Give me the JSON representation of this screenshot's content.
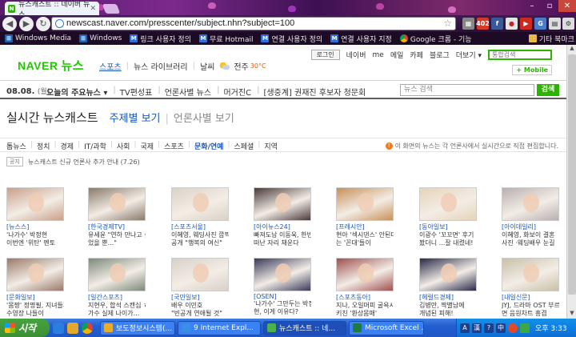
{
  "browser": {
    "tabs": [
      {
        "label": "뉴스캐스트 :: 네이버 뉴스",
        "active": true
      },
      {
        "label": "",
        "active": false
      }
    ],
    "url": "newscast.naver.com/presscenter/subject.nhn?subject=100"
  },
  "bookmarks": [
    {
      "label": "Windows Media",
      "icon": "windows-icon"
    },
    {
      "label": "Windows",
      "icon": "windows-icon"
    },
    {
      "label": "링크 사용자 정의",
      "icon": "ms-icon"
    },
    {
      "label": "무료 Hotmail",
      "icon": "ms-icon"
    },
    {
      "label": "연결 사용자 정의",
      "icon": "ms-icon"
    },
    {
      "label": "연결 사용자 지정",
      "icon": "ms-icon"
    },
    {
      "label": "Google 크롬 - 기능",
      "icon": "chrome-icon"
    },
    {
      "label": "기타 북마크",
      "icon": "folder-icon"
    }
  ],
  "naver": {
    "logo": "NAVER",
    "logo_news": "뉴스",
    "top_menu": [
      "스포츠",
      "뉴스 라이브러리",
      "날씨"
    ],
    "weather": {
      "city": "전주",
      "temp": "30°C"
    },
    "nav_links": [
      "로그인",
      "네이버",
      "me",
      "메일",
      "카페",
      "블로그",
      "더보기 ▾"
    ],
    "top_search_placeholder": "통합검색",
    "mobile": "+ Mobile",
    "date": "08.08.",
    "day": "(월)",
    "sub_menu": [
      "오늘의 주요뉴스 ▾",
      "TV편성표",
      "언론사별 뉴스",
      "머거진C",
      "[생중계] 권재진 후보자 청문회"
    ],
    "news_search_placeholder": "뉴스 검색",
    "search_button": "검색",
    "page_title": "실시간 뉴스캐스트",
    "view_by_topic": "주제별 보기",
    "view_by_press": "언론사별 보기",
    "categories": [
      "톱뉴스",
      "정치",
      "경제",
      "IT/과학",
      "사회",
      "국제",
      "스포츠",
      "문화/연예",
      "스페셜",
      "지역"
    ],
    "active_category": "문화/연예",
    "category_note": "이 화면의 뉴스는 각 언론사에서 실시간으로 직접 편집합니다.",
    "notice_tag": "공지",
    "notice_text": "뉴스캐스트 신규 언론사 추가 안내 (7.26)"
  },
  "cards": [
    {
      "source": "[뉴스스]",
      "line1": "'나가수' 박정현",
      "line2": "이번엔 '위탄' 멘토",
      "color": "#c9a08a"
    },
    {
      "source": "[한국경제TV]",
      "line1": "유세윤 \"연하 만나고 싶",
      "line2": "었을 뿐...\"",
      "color": "#8a7a6a"
    },
    {
      "source": "[스포츠서울]",
      "line1": "이혜영, 웨딩사진 깜짝",
      "line2": "공개 \"행복의 여신\"",
      "color": "#d9d2c6"
    },
    {
      "source": "[아이뉴스24]",
      "line1": "빠져도남 이동욱, 한빈",
      "line2": "떠난 자리 채운다",
      "color": "#4a3a3a"
    },
    {
      "source": "[프레시안]",
      "line1": "현아 '섹시댄스' 안된다",
      "line2": "는 '꼰대'들이",
      "color": "#c8915a"
    },
    {
      "source": "[동아일보]",
      "line1": "이광수 '꼬꼬면' 후기",
      "line2": "봤더니 ...잘 내켰네!",
      "color": "#e6d3b8"
    },
    {
      "source": "[아이데일리]",
      "line1": "이혜영, 화보이 결혼",
      "line2": "사진 ·웨딩배우 눈길",
      "color": "#b8b0b0"
    },
    {
      "source": "[문화일보]",
      "line1": "'몸짱' 정명필, 지녀들과",
      "line2": "수영장 나들이",
      "color": "#9a7a6a"
    },
    {
      "source": "[일간스포츠]",
      "line1": "지현우, 합석 스캔십 ㅎ",
      "line2": "가수 실제 나이가...",
      "color": "#7d8a7a"
    },
    {
      "source": "[국민일보]",
      "line1": "배우 이민호",
      "line2": "\"빈공개 연애될 것\"",
      "color": "#d8d0c8"
    },
    {
      "source": "[OSEN]",
      "line1": "'나가수' 그만두는 박정",
      "line2": "현, 이게 이유다?",
      "color": "#3a3a5a"
    },
    {
      "source": "[스포츠동아]",
      "line1": "지나, 오일머피 굴욕시",
      "line2": "키친 '환상몸매'",
      "color": "#a05050"
    },
    {
      "source": "[헤럴드경제]",
      "line1": "김병만, 짝별남에",
      "line2": "개념된 피해!",
      "color": "#2a2a4a"
    },
    {
      "source": "[내일신문]",
      "line1": "JYJ, 드라마 OST 부르",
      "line2": "면 음원차트 흥겹",
      "color": "#c8c0a8"
    }
  ],
  "taskbar": {
    "start": "시작",
    "tasks": [
      {
        "label": "보도정보시스템(...",
        "icon": "#e8ad2e"
      },
      {
        "label": "9 Internet Expl...",
        "icon": "#3a8ee6"
      },
      {
        "label": "뉴스캐스트 :: 네...",
        "icon": "#4caf50",
        "active": true
      },
      {
        "label": "Microsoft Excel ...",
        "icon": "#1f7a3d"
      }
    ],
    "tray_letters": [
      "A",
      "漢",
      "?",
      "中"
    ],
    "clock": "오후 3:33"
  }
}
